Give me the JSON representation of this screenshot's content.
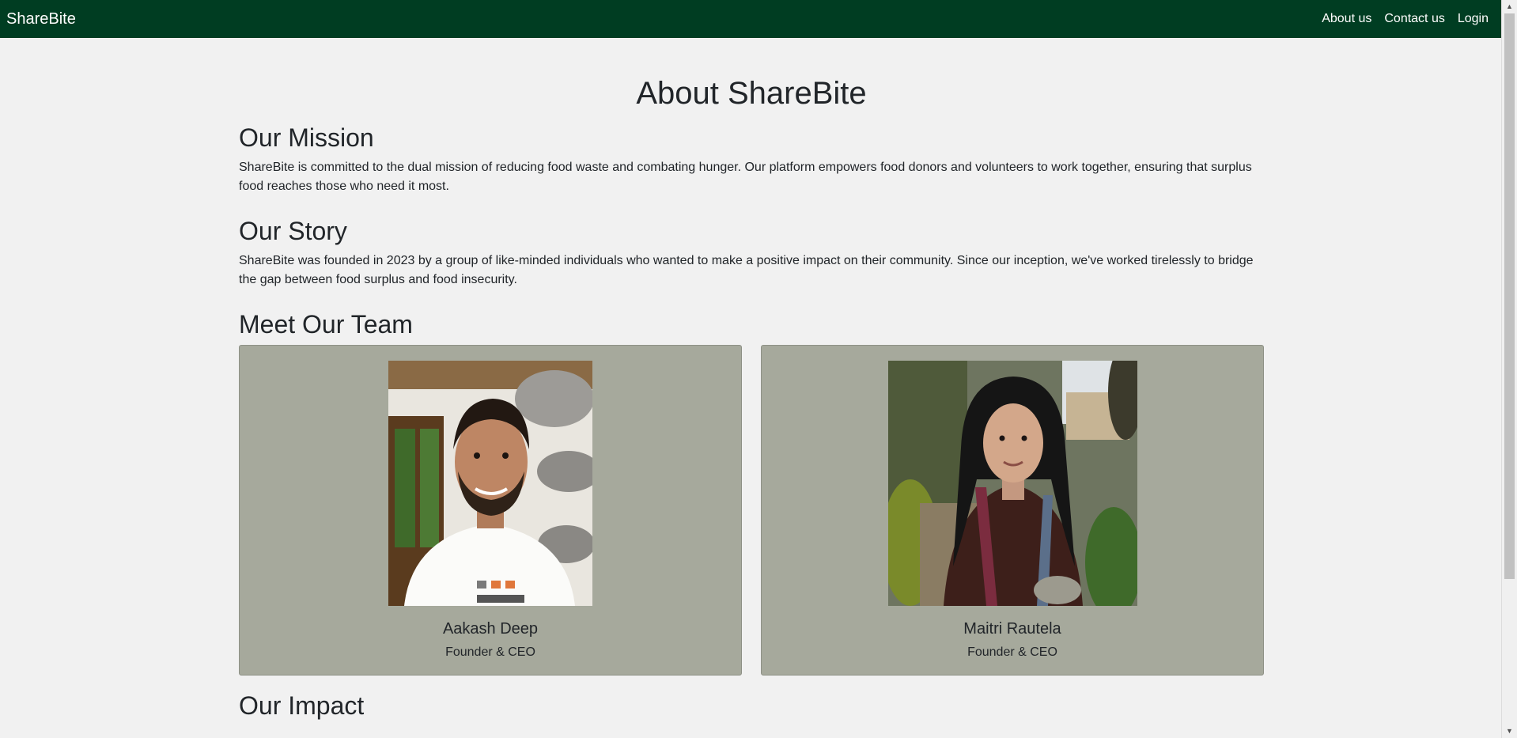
{
  "navbar": {
    "brand": "ShareBite",
    "links": [
      "About us",
      "Contact us",
      "Login"
    ]
  },
  "page": {
    "title": "About ShareBite"
  },
  "mission": {
    "title": "Our Mission",
    "text": "ShareBite is committed to the dual mission of reducing food waste and combating hunger. Our platform empowers food donors and volunteers to work together, ensuring that surplus food reaches those who need it most."
  },
  "story": {
    "title": "Our Story",
    "text": "ShareBite was founded in 2023 by a group of like-minded individuals who wanted to make a positive impact on their community. Since our inception, we've worked tirelessly to bridge the gap between food surplus and food insecurity."
  },
  "team": {
    "title": "Meet Our Team",
    "members": [
      {
        "name": "Aakash Deep",
        "role": "Founder & CEO"
      },
      {
        "name": "Maitri Rautela",
        "role": "Founder & CEO"
      }
    ]
  },
  "impact": {
    "title": "Our Impact"
  },
  "colors": {
    "navbar": "#003d22",
    "page_background": "#f1f1f1",
    "card_background": "#a6a99c"
  }
}
